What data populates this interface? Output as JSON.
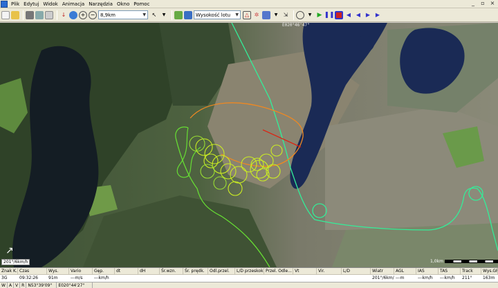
{
  "menu": {
    "items": [
      {
        "label": "Plik"
      },
      {
        "label": "Edytuj"
      },
      {
        "label": "Widok"
      },
      {
        "label": "Animacja"
      },
      {
        "label": "Narzędzia"
      },
      {
        "label": "Okno"
      },
      {
        "label": "Pomoc"
      }
    ],
    "window_controls": [
      "_",
      "▫",
      "×"
    ]
  },
  "toolbar": {
    "zoom_value": "8,9km",
    "altitude_mode": "Wysokość lotu"
  },
  "map": {
    "top_coordinate": "E020°46'47\"",
    "wind_label": "201°/6km/h",
    "scale_label": "1,0km"
  },
  "table": {
    "headers": [
      "Znak K.",
      "Czas",
      "Wys.",
      "Vario",
      "Gęp.",
      "dt",
      "dH",
      "Śr.wzn.",
      "Śr. prędk.",
      "Odl.przel.",
      "L/D przeskok",
      "Przel. Odle...",
      "Vt",
      "Vir.",
      "L/D",
      "Wiatr",
      "AGL",
      "IAS",
      "TAS",
      "Track",
      "Wys.GP"
    ],
    "values": [
      "3G",
      "09:32:26",
      "91m",
      "---m/s",
      "---km/h",
      "",
      "",
      "",
      "",
      "",
      "",
      "",
      "",
      "",
      "",
      "201°/6km/h---m",
      "---m",
      "---km/h",
      "---km/h",
      "211°",
      "163m"
    ]
  },
  "status": {
    "items": [
      "W",
      "A",
      "V",
      "R",
      "N53°39'09\"",
      "E020°44'27\""
    ]
  },
  "colors": {
    "track_green": "#66dd33",
    "track_yellow": "#ccee22",
    "track_orange": "#ee8822",
    "track_red": "#dd2211",
    "track_cyan": "#33ee99",
    "lake": "#1a2a55"
  }
}
